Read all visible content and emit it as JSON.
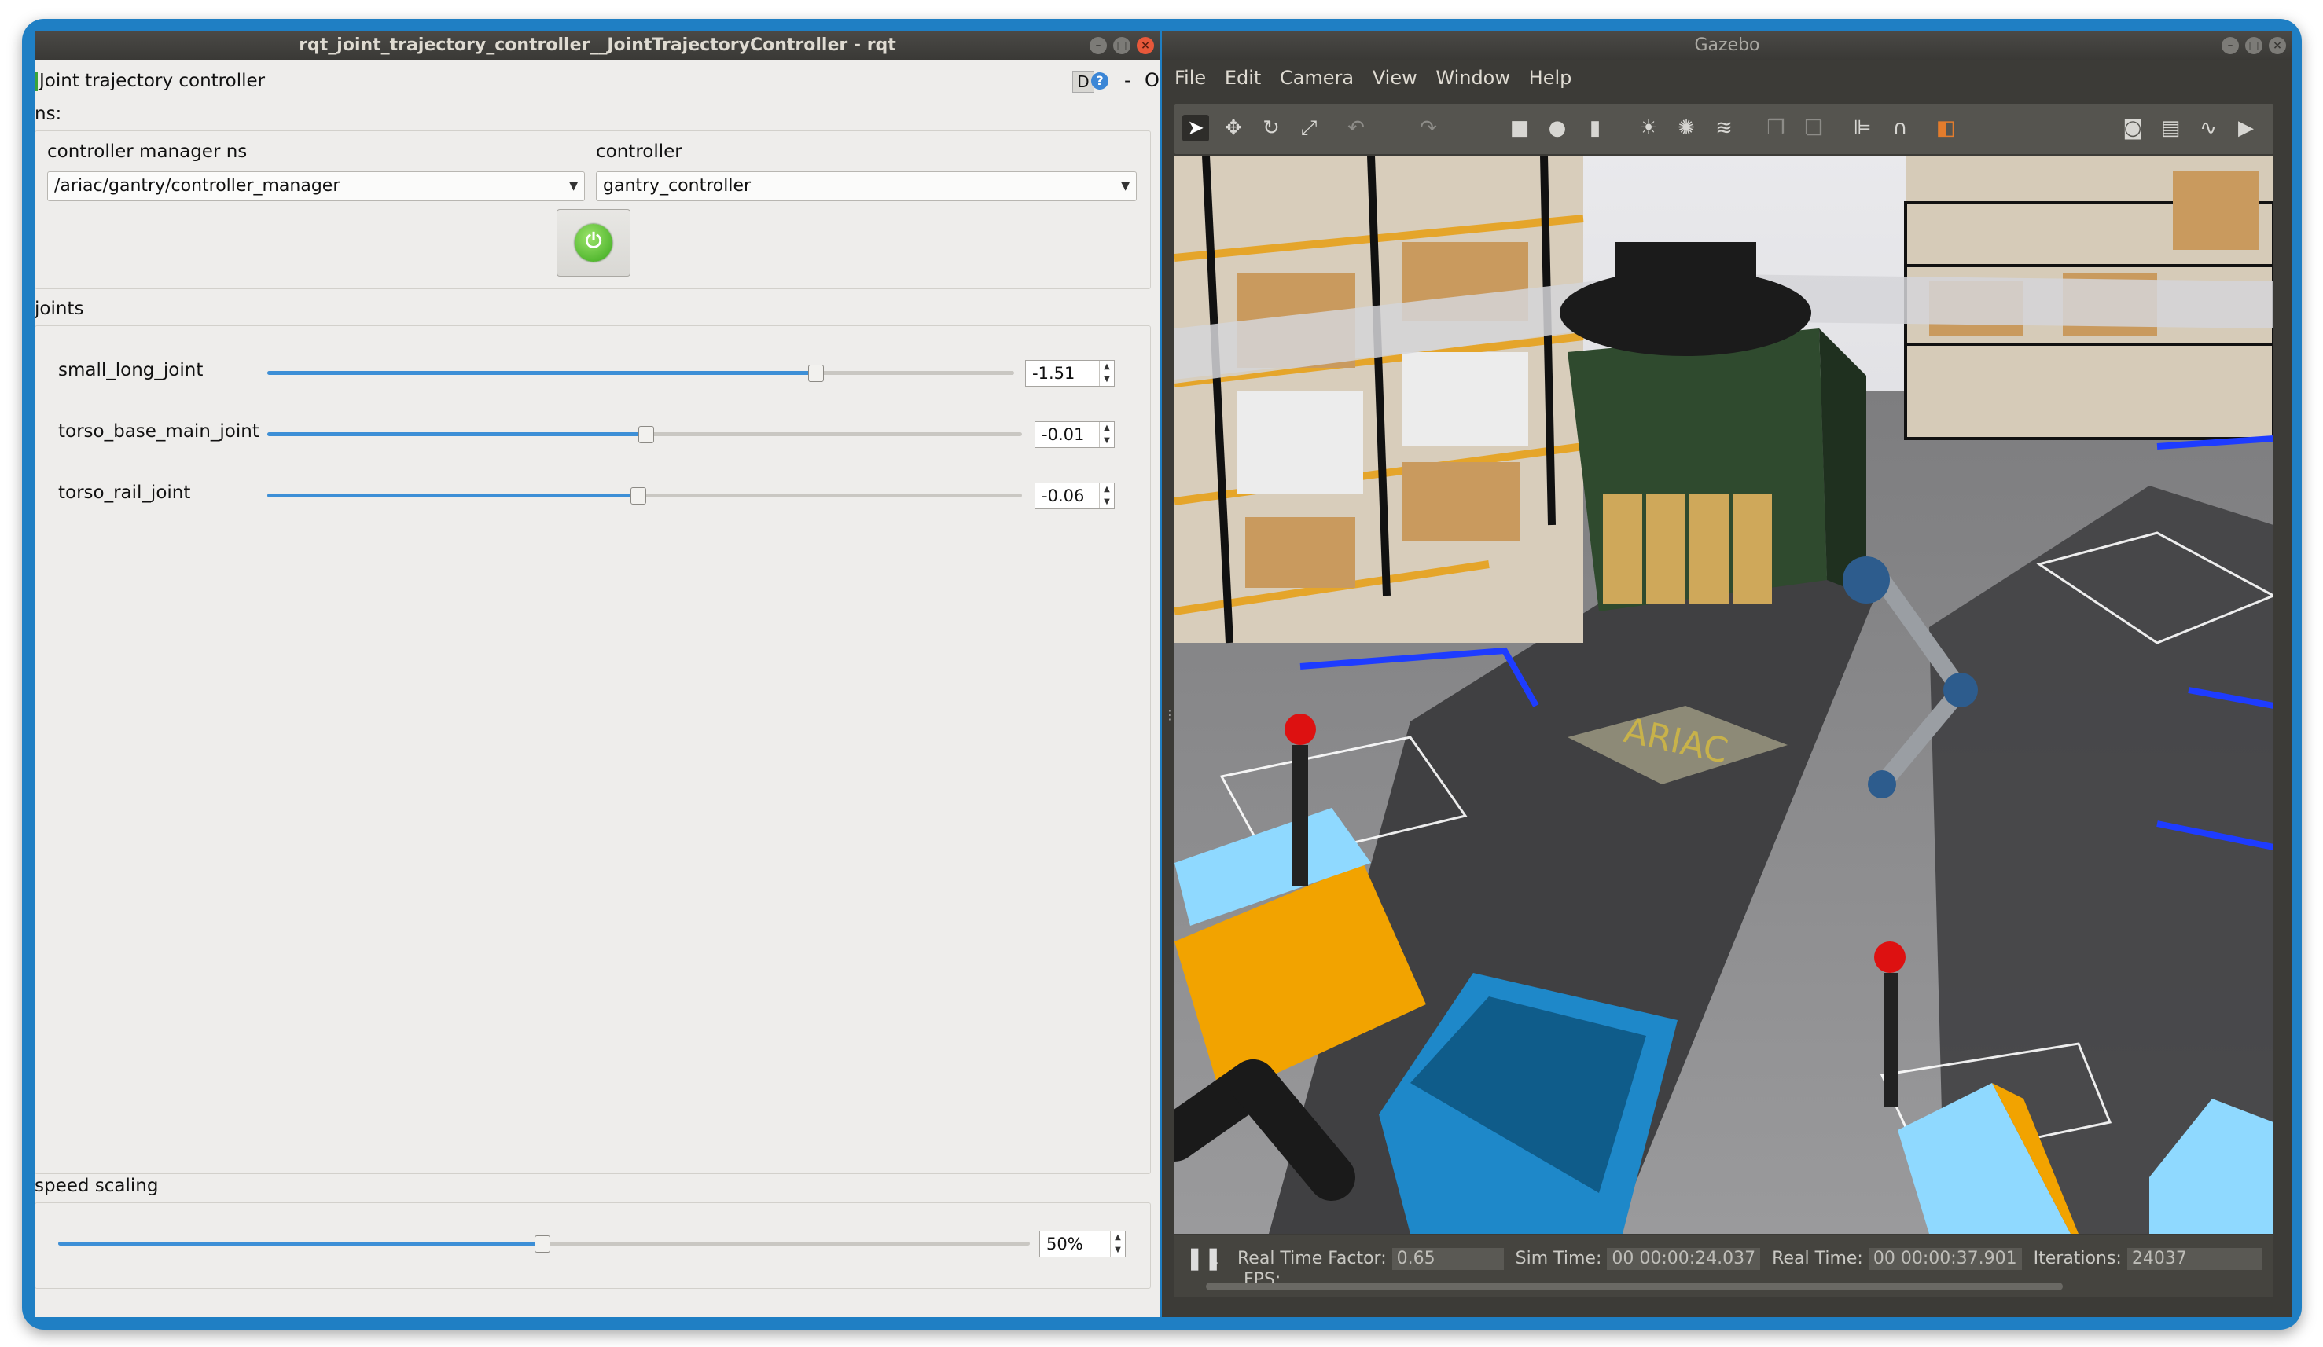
{
  "rqt": {
    "title": "rqt_joint_trajectory_controller__JointTrajectoryController - rqt",
    "plugin_title": "Joint trajectory controller",
    "plugin_buttons": {
      "d": "D",
      "help": "?",
      "minimize": "-",
      "close": "O"
    },
    "ns_label": "ns:",
    "controller_manager_ns_label": "controller manager ns",
    "controller_manager_ns_value": "/ariac/gantry/controller_manager",
    "controller_label": "controller",
    "controller_value": "gantry_controller",
    "joints_label": "joints",
    "joints": [
      {
        "name": "small_long_joint",
        "value": "-1.51",
        "fraction": 0.73
      },
      {
        "name": "torso_base_main_joint",
        "value": "-0.01",
        "fraction": 0.5
      },
      {
        "name": "torso_rail_joint",
        "value": "-0.06",
        "fraction": 0.49
      }
    ],
    "speed_scaling_label": "speed scaling",
    "speed_scaling_value": "50%",
    "speed_scaling_fraction": 0.5
  },
  "gazebo": {
    "title": "Gazebo",
    "menu": [
      "File",
      "Edit",
      "Camera",
      "View",
      "Window",
      "Help"
    ],
    "toolbar_icons": [
      "select-arrow-icon",
      "translate-icon",
      "rotate-icon",
      "scale-icon",
      "undo-icon",
      "redo-icon",
      "box-icon",
      "sphere-icon",
      "cylinder-icon",
      "point-light-icon",
      "spot-light-icon",
      "directional-light-icon",
      "copy-icon",
      "paste-icon",
      "align-icon",
      "snap-icon",
      "view-angle-icon",
      "screenshot-icon",
      "log-icon",
      "plot-icon",
      "record-icon"
    ],
    "sign_text": "ARIAC",
    "status": {
      "pause_icon": "pause-icon",
      "real_time_factor_label": "Real Time Factor:",
      "real_time_factor": "0.65",
      "sim_time_label": "Sim Time:",
      "sim_time": "00 00:00:24.037",
      "real_time_label": "Real Time:",
      "real_time": "00 00:00:37.901",
      "iterations_label": "Iterations:",
      "iterations": "24037",
      "fps_label": "FPS:"
    }
  }
}
